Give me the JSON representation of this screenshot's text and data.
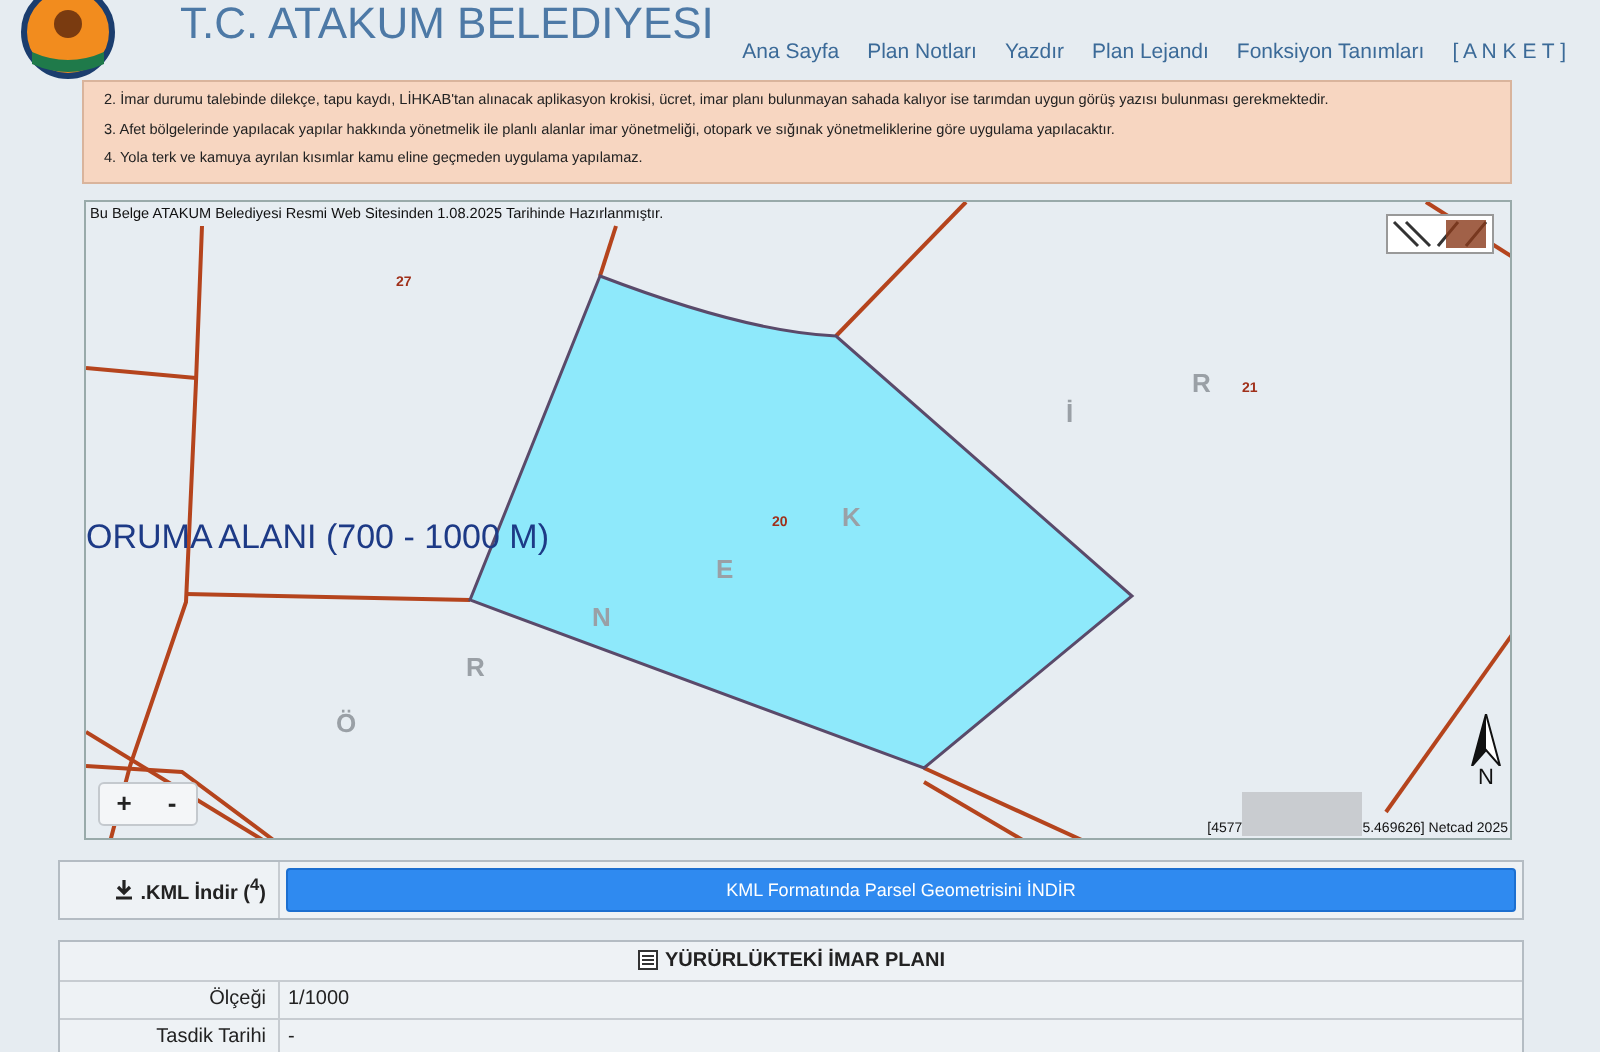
{
  "header": {
    "title": "T.C. ATAKUM BELEDIYESI"
  },
  "nav": [
    {
      "label": "Ana Sayfa"
    },
    {
      "label": "Plan Notları"
    },
    {
      "label": "Yazdır"
    },
    {
      "label": "Plan Lejandı"
    },
    {
      "label": "Fonksiyon Tanımları"
    },
    {
      "label": "[ A N K E T ]"
    }
  ],
  "notes": [
    "2. İmar durumu talebinde dilekçe, tapu kaydı, LİHKAB'tan alınacak aplikasyon krokisi, ücret, imar planı bulunmayan sahada kalıyor ise tarımdan uygun görüş yazısı bulunması gerekmektedir.",
    "3. Afet bölgelerinde yapılacak yapılar hakkında yönetmelik ile planlı alanlar imar yönetmeliği, otopark ve sığınak yönetmeliklerine göre uygulama yapılacaktır.",
    "4. Yola terk ve kamuya ayrılan kısımlar kamu eline geçmeden uygulama yapılamaz."
  ],
  "map": {
    "notice": "Bu Belge ATAKUM Belediyesi Resmi Web Sitesinden 1.08.2025 Tarihinde Hazırlanmıştır.",
    "parcel_numbers": [
      "27",
      "21",
      "20"
    ],
    "zone_label": "ORUMA ALANI (700 - 1000 M)",
    "street_letters": [
      "Ö",
      "R",
      "N",
      "E",
      "K",
      "İ",
      "R"
    ],
    "zoom_in": "+",
    "zoom_out": "-",
    "north": "N",
    "coords_left": "[4577",
    "coords_right": "5.469626] Netcad 2025"
  },
  "kml": {
    "label": ".KML İndir ($^{4}$)",
    "button": "KML Formatında Parsel Geometrisini İNDİR"
  },
  "plan_table": {
    "title": "YÜRÜRLÜKTEKİ İMAR PLANI",
    "rows": [
      {
        "label": "Ölçeği",
        "value": "1/1000"
      },
      {
        "label": "Tasdik Tarihi",
        "value": "-"
      }
    ]
  }
}
